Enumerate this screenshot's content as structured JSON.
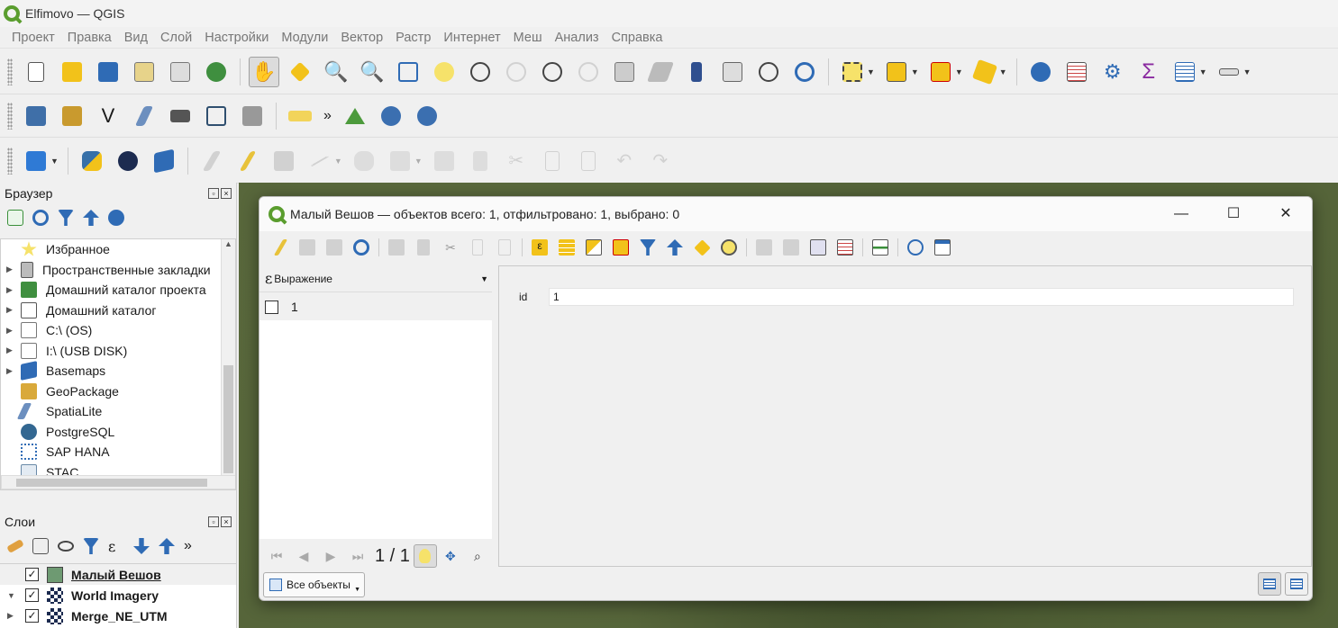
{
  "window": {
    "title": "Elfimovo — QGIS"
  },
  "menu": [
    "Проект",
    "Правка",
    "Вид",
    "Слой",
    "Настройки",
    "Модули",
    "Вектор",
    "Растр",
    "Интернет",
    "Меш",
    "Анализ",
    "Справка"
  ],
  "colors": {
    "accent": "#5a9d2e",
    "icon_blue": "#2f6bb5",
    "icon_yellow": "#f2c21a",
    "icon_purple": "#8a2aa0",
    "disabled": "#bbbbbb"
  },
  "browser": {
    "title": "Браузер",
    "items": [
      {
        "label": "Избранное",
        "icon": "star-icon",
        "expandable": false
      },
      {
        "label": "Пространственные закладки",
        "icon": "bookmark-icon",
        "expandable": true
      },
      {
        "label": "Домашний каталог проекта",
        "icon": "project-folder-icon",
        "expandable": true
      },
      {
        "label": "Домашний каталог",
        "icon": "home-icon",
        "expandable": true
      },
      {
        "label": "C:\\ (OS)",
        "icon": "drive-icon",
        "expandable": true
      },
      {
        "label": "I:\\ (USB DISK)",
        "icon": "drive-icon",
        "expandable": true
      },
      {
        "label": "Basemaps",
        "icon": "basemaps-icon",
        "expandable": true
      },
      {
        "label": "GeoPackage",
        "icon": "geopackage-icon",
        "expandable": false
      },
      {
        "label": "SpatiaLite",
        "icon": "spatialite-icon",
        "expandable": false
      },
      {
        "label": "PostgreSQL",
        "icon": "postgresql-icon",
        "expandable": false
      },
      {
        "label": "SAP HANA",
        "icon": "sap-hana-icon",
        "expandable": false
      },
      {
        "label": "STAC",
        "icon": "stac-icon",
        "expandable": false
      }
    ]
  },
  "layers": {
    "title": "Слои",
    "items": [
      {
        "label": "Малый Вешов",
        "checked": true,
        "swatch": "#6e9a72",
        "underline": true
      },
      {
        "label": "World Imagery",
        "checked": true,
        "swatch": "raster"
      },
      {
        "label": "Merge_NE_UTM",
        "checked": true,
        "swatch": "raster"
      }
    ]
  },
  "dialog": {
    "title": "Малый Вешов — объектов всего: 1, отфильтровано: 1, выбрано: 0",
    "expression_label": "Выражение",
    "features": [
      "1"
    ],
    "field": {
      "name": "id",
      "value": "1"
    },
    "page": "1 / 1",
    "filter_label": "Все объекты"
  }
}
